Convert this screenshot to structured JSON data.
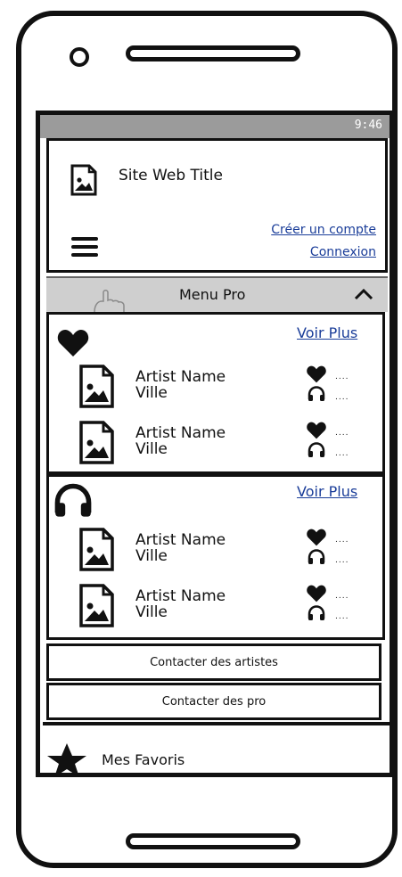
{
  "status_bar": {
    "time": "9:46"
  },
  "header": {
    "site_title": "Site Web Title",
    "create_account": "Créer un compte",
    "login": "Connexion"
  },
  "menu": {
    "label": "Menu Pro"
  },
  "sections": [
    {
      "icon": "heart-icon",
      "voir_plus": "Voir Plus",
      "artists": [
        {
          "name": "Artist Name",
          "city": "Ville",
          "likes": "....",
          "listens": "...."
        },
        {
          "name": "Artist Name",
          "city": "Ville",
          "likes": "....",
          "listens": "...."
        }
      ]
    },
    {
      "icon": "headphones-icon",
      "voir_plus": "Voir Plus",
      "artists": [
        {
          "name": "Artist Name",
          "city": "Ville",
          "likes": "....",
          "listens": "...."
        },
        {
          "name": "Artist Name",
          "city": "Ville",
          "likes": "....",
          "listens": "...."
        }
      ]
    }
  ],
  "buttons": {
    "contact_artists": "Contacter des artistes",
    "contact_pro": "Contacter des pro"
  },
  "favorites": {
    "label": "Mes Favoris"
  }
}
